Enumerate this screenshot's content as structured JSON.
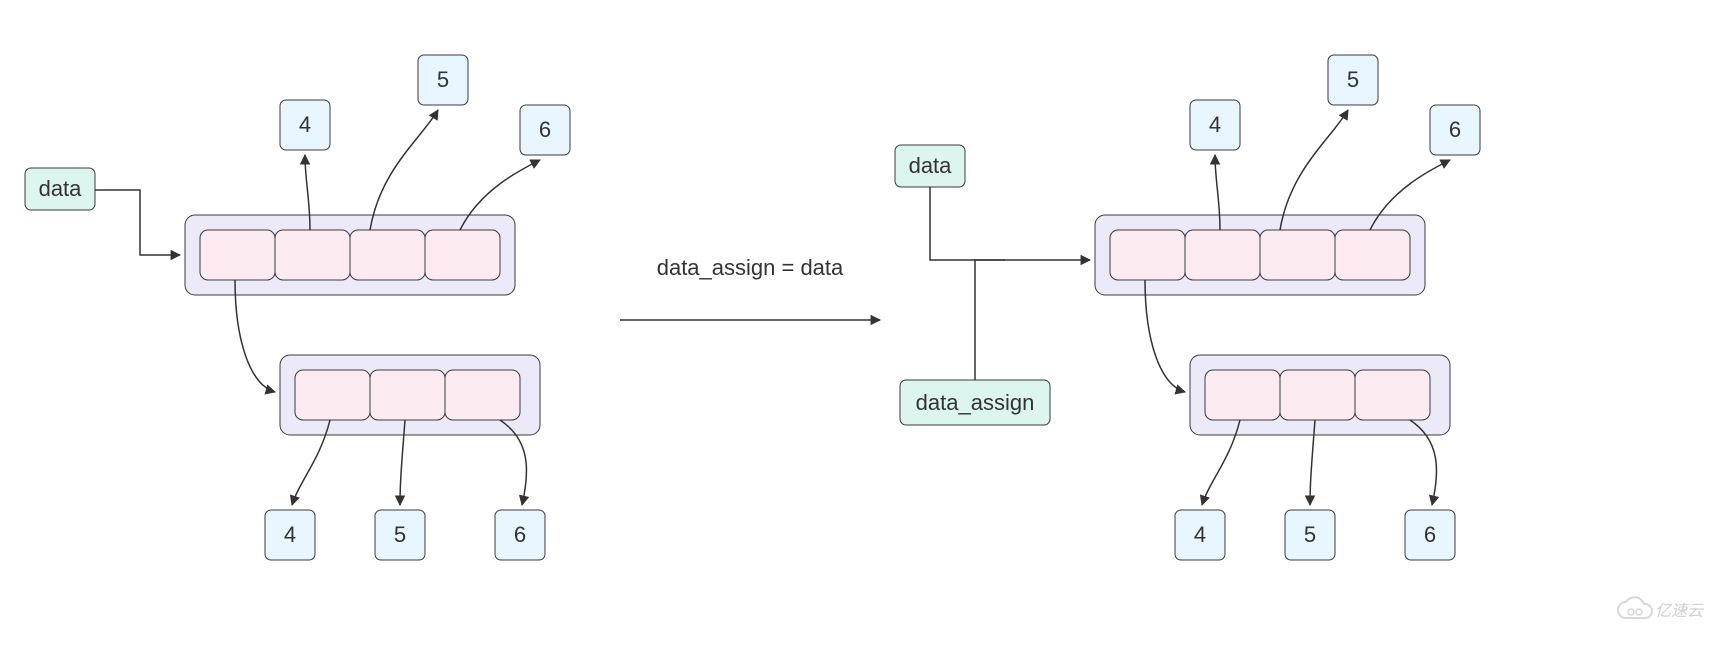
{
  "left": {
    "data_label": "data",
    "top_outer": {
      "slots": 4
    },
    "top_values": [
      "4",
      "5",
      "6"
    ],
    "bottom_inner": {
      "slots": 3
    },
    "bottom_values": [
      "4",
      "5",
      "6"
    ]
  },
  "center": {
    "caption": "data_assign = data"
  },
  "right": {
    "data_label": "data",
    "assign_label": "data_assign",
    "top_outer": {
      "slots": 4
    },
    "top_values": [
      "4",
      "5",
      "6"
    ],
    "bottom_inner": {
      "slots": 3
    },
    "bottom_values": [
      "4",
      "5",
      "6"
    ]
  },
  "watermark": "亿速云"
}
